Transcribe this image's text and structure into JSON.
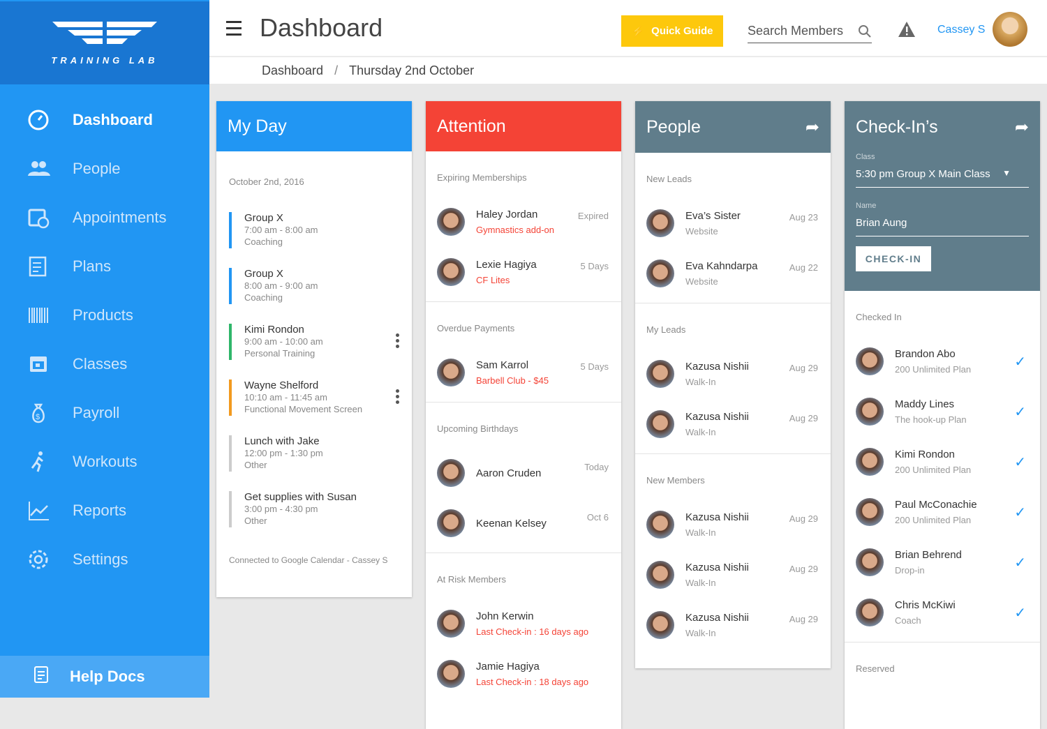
{
  "brand": {
    "name": "TRAINING LAB"
  },
  "sidebar": {
    "items": [
      {
        "label": "Dashboard",
        "icon": "dashboard-icon"
      },
      {
        "label": "People",
        "icon": "people-icon"
      },
      {
        "label": "Appointments",
        "icon": "appointments-icon"
      },
      {
        "label": "Plans",
        "icon": "plans-icon"
      },
      {
        "label": "Products",
        "icon": "barcode-icon"
      },
      {
        "label": "Classes",
        "icon": "calendar-icon"
      },
      {
        "label": "Payroll",
        "icon": "money-bag-icon"
      },
      {
        "label": "Workouts",
        "icon": "runner-icon"
      },
      {
        "label": "Reports",
        "icon": "chart-icon"
      },
      {
        "label": "Settings",
        "icon": "gear-icon"
      }
    ],
    "active": "Dashboard",
    "help": "Help Docs"
  },
  "header": {
    "title": "Dashboard",
    "quick_guide": "Quick Guide",
    "search_placeholder": "Search Members",
    "user": "Cassey S"
  },
  "breadcrumb": [
    "Dashboard",
    "Thursday 2nd October"
  ],
  "colors": {
    "sidebar": "#2196f3",
    "myday": "#2196f3",
    "attention": "#f44336",
    "people": "#607d8b",
    "accent": "#fdc80c"
  },
  "myday": {
    "title": "My Day",
    "date": "October 2nd, 2016",
    "events": [
      {
        "name": "Group X",
        "time": "7:00 am - 8:00 am",
        "type": "Coaching",
        "color": "#2196f3",
        "menu": false
      },
      {
        "name": "Group X",
        "time": "8:00 am - 9:00 am",
        "type": "Coaching",
        "color": "#2196f3",
        "menu": false
      },
      {
        "name": "Kimi Rondon",
        "time": "9:00 am - 10:00 am",
        "type": "Personal Training",
        "color": "#2fb66a",
        "menu": true
      },
      {
        "name": "Wayne Shelford",
        "time": "10:10 am - 11:45 am",
        "type": "Functional Movement Screen",
        "color": "#f29a1f",
        "menu": true
      },
      {
        "name": "Lunch with Jake",
        "time": "12:00 pm - 1:30 pm",
        "type": "Other",
        "color": "#cccccc",
        "menu": false
      },
      {
        "name": "Get supplies with Susan",
        "time": "3:00 pm - 4:30 pm",
        "type": "Other",
        "color": "#cccccc",
        "menu": false
      }
    ],
    "footer": "Connected to Google Calendar - Cassey S"
  },
  "attention": {
    "title": "Attention",
    "sections": [
      {
        "title": "Expiring Memberships",
        "items": [
          {
            "name": "Haley Jordan",
            "sub": "Gymnastics add-on",
            "right": "Expired"
          },
          {
            "name": "Lexie Hagiya",
            "sub": "CF Lites",
            "right": "5 Days"
          }
        ]
      },
      {
        "title": "Overdue Payments",
        "items": [
          {
            "name": "Sam Karrol",
            "sub": "Barbell Club - $45",
            "right": "5 Days"
          }
        ]
      },
      {
        "title": "Upcoming Birthdays",
        "items": [
          {
            "name": "Aaron Cruden",
            "sub": "",
            "right": "Today"
          },
          {
            "name": "Keenan Kelsey",
            "sub": "",
            "right": "Oct 6"
          }
        ]
      },
      {
        "title": "At Risk Members",
        "items": [
          {
            "name": "John Kerwin",
            "sub": "Last Check-in : 16 days ago",
            "right": ""
          },
          {
            "name": "Jamie Hagiya",
            "sub": "Last Check-in : 18 days ago",
            "right": ""
          }
        ]
      }
    ]
  },
  "people": {
    "title": "People",
    "sections": [
      {
        "title": "New Leads",
        "items": [
          {
            "name": "Eva’s Sister",
            "sub": "Website",
            "right": "Aug 23"
          },
          {
            "name": "Eva Kahndarpa",
            "sub": "Website",
            "right": "Aug 22"
          }
        ]
      },
      {
        "title": "My Leads",
        "items": [
          {
            "name": "Kazusa Nishii",
            "sub": "Walk-In",
            "right": "Aug 29"
          },
          {
            "name": "Kazusa Nishii",
            "sub": "Walk-In",
            "right": "Aug 29"
          }
        ]
      },
      {
        "title": "New Members",
        "items": [
          {
            "name": "Kazusa Nishii",
            "sub": "Walk-In",
            "right": "Aug 29"
          },
          {
            "name": "Kazusa Nishii",
            "sub": "Walk-In",
            "right": "Aug 29"
          },
          {
            "name": "Kazusa Nishii",
            "sub": "Walk-In",
            "right": "Aug 29"
          }
        ]
      }
    ]
  },
  "checkins": {
    "title": "Check-In’s",
    "class_label": "Class",
    "class_value": "5:30 pm Group X  Main Class",
    "name_label": "Name",
    "name_value": "Brian Aung",
    "button": "CHECK-IN",
    "checked_title": "Checked In",
    "checked": [
      {
        "name": "Brandon Abo",
        "sub": "200 Unlimited Plan"
      },
      {
        "name": "Maddy Lines",
        "sub": "The hook-up Plan"
      },
      {
        "name": "Kimi Rondon",
        "sub": "200 Unlimited Plan"
      },
      {
        "name": "Paul McConachie",
        "sub": "200 Unlimited Plan"
      },
      {
        "name": "Brian Behrend",
        "sub": "Drop-in"
      },
      {
        "name": "Chris McKiwi",
        "sub": "Coach"
      }
    ],
    "reserved_title": "Reserved"
  }
}
